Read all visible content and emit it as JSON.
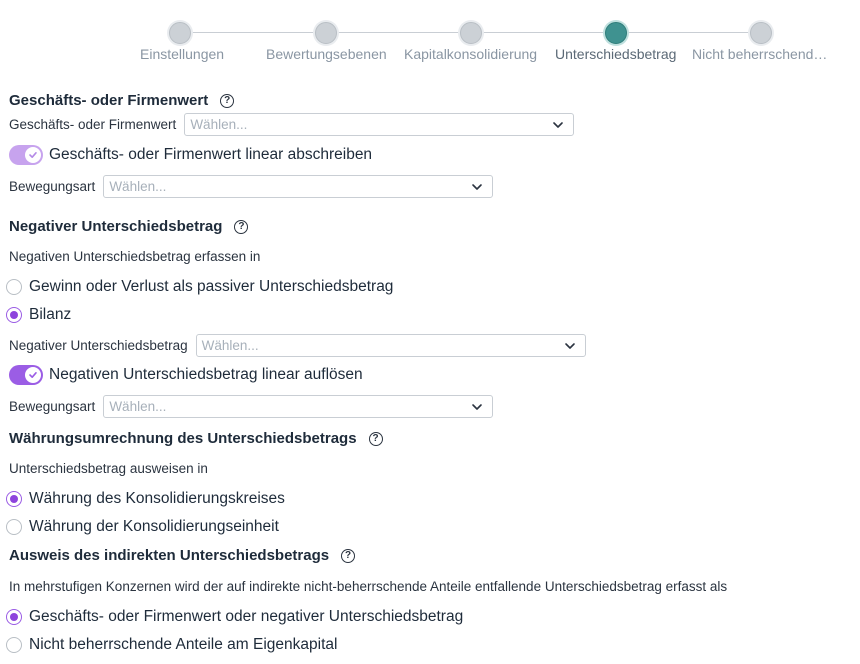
{
  "stepper": {
    "steps": [
      {
        "label": "Einstellungen",
        "state": "done"
      },
      {
        "label": "Bewertungsebenen",
        "state": "done"
      },
      {
        "label": "Kapitalkonsolidierung",
        "state": "done"
      },
      {
        "label": "Unterschiedsbetrag",
        "state": "active"
      },
      {
        "label": "Nicht beherrschend…",
        "state": "todo"
      }
    ]
  },
  "goodwill": {
    "title": "Geschäfts- oder Firmenwert",
    "help_icon": "?",
    "field_label": "Geschäfts- oder Firmenwert",
    "field_placeholder": "Wählen...",
    "toggle_label": "Geschäfts- oder Firmenwert linear abschreiben",
    "movement_label": "Bewegungsart",
    "movement_placeholder": "Wählen..."
  },
  "negative": {
    "title": "Negativer Unterschiedsbetrag",
    "help_icon": "?",
    "intro": "Negativen Unterschiedsbetrag erfassen in",
    "options": [
      {
        "label": "Gewinn oder Verlust als passiver Unterschiedsbetrag",
        "checked": false
      },
      {
        "label": "Bilanz",
        "checked": true
      }
    ],
    "field_label": "Negativer Unterschiedsbetrag",
    "field_placeholder": "Wählen...",
    "toggle_label": "Negativen Unterschiedsbetrag linear auflösen",
    "movement_label": "Bewegungsart",
    "movement_placeholder": "Wählen..."
  },
  "currency": {
    "title": "Währungsumrechnung des Unterschiedsbetrags",
    "help_icon": "?",
    "intro": "Unterschiedsbetrag ausweisen in",
    "options": [
      {
        "label": "Währung des Konsolidierungskreises",
        "checked": true
      },
      {
        "label": "Währung der Konsolidierungseinheit",
        "checked": false
      }
    ]
  },
  "indirect": {
    "title": "Ausweis des indirekten Unterschiedsbetrags",
    "help_icon": "?",
    "intro": "In mehrstufigen Konzernen wird der auf indirekte nicht-beherrschende Anteile entfallende Unterschiedsbetrag erfasst als",
    "options": [
      {
        "label": "Geschäfts- oder Firmenwert oder negativer Unterschiedsbetrag",
        "checked": true
      },
      {
        "label": "Nicht beherrschende Anteile am Eigenkapital",
        "checked": false
      }
    ]
  },
  "colors": {
    "accent": "#9b5de5",
    "active_step": "#3f9290"
  }
}
